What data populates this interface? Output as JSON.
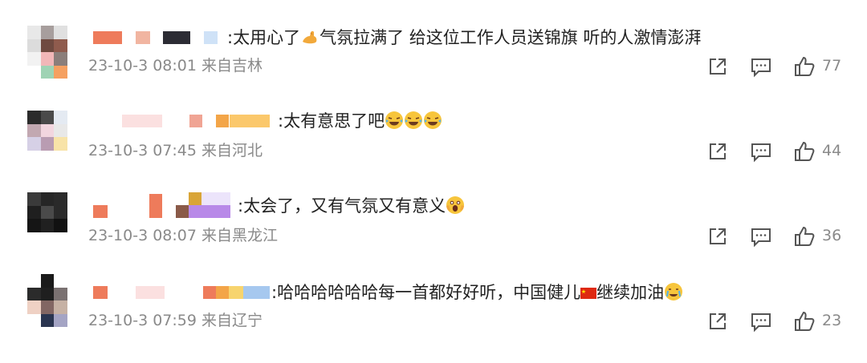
{
  "comments": [
    {
      "text_before": ":太用心了",
      "text_after": "气氛拉满了 给这位工作人员送锦旗 听的人激情澎湃",
      "emoji": "flexed-biceps",
      "time": "23-10-3 08:01",
      "location": "来自吉林",
      "likes": "77"
    },
    {
      "text_before": ":太有意思了吧",
      "text_after": "",
      "emoji": "laughing-crying",
      "time": "23-10-3 07:45",
      "location": "来自河北",
      "likes": "44"
    },
    {
      "text_before": ":太会了，又有气氛又有意义",
      "text_after": "",
      "emoji": "screaming-face",
      "time": "23-10-3 08:07",
      "location": "来自黑龙江",
      "likes": "36"
    },
    {
      "text_before": ":哈哈哈哈哈哈每一首都好好听，中国健儿",
      "text_after": "继续加油",
      "emoji": "china-flag",
      "emoji2": "crying-cheering",
      "time": "23-10-3 07:59",
      "location": "来自辽宁",
      "likes": "23"
    }
  ],
  "icons": {
    "share": "share-icon",
    "comment": "comment-icon",
    "like": "thumbs-up-icon"
  }
}
